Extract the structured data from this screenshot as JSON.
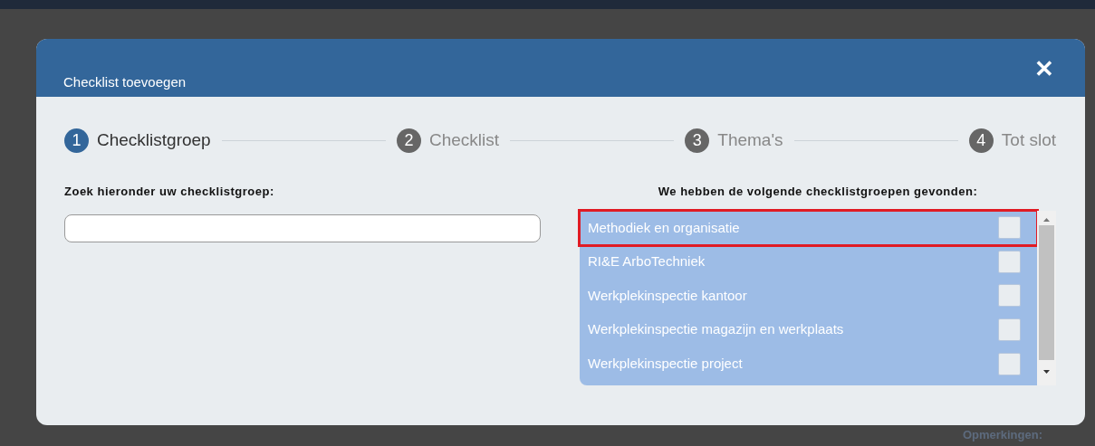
{
  "dialog": {
    "title": "Checklist toevoegen",
    "close": "✕"
  },
  "steps": [
    {
      "number": "1",
      "label": "Checklistgroep",
      "selected": true
    },
    {
      "number": "2",
      "label": "Checklist",
      "selected": false
    },
    {
      "number": "3",
      "label": "Thema's",
      "selected": false
    },
    {
      "number": "4",
      "label": "Tot slot",
      "selected": false
    }
  ],
  "search": {
    "label": "Zoek hieronder uw checklistgroep:"
  },
  "results": {
    "heading": "We hebben de volgende checklistgroepen gevonden:",
    "items": [
      {
        "label": "Methodiek en organisatie",
        "checked": false,
        "highlighted": true
      },
      {
        "label": "RI&E ArboTechniek",
        "checked": false,
        "highlighted": false
      },
      {
        "label": "Werkplekinspectie kantoor",
        "checked": false,
        "highlighted": false
      },
      {
        "label": "Werkplekinspectie magazijn en werkplaats",
        "checked": false,
        "highlighted": false
      },
      {
        "label": "Werkplekinspectie project",
        "checked": false,
        "highlighted": false
      }
    ]
  },
  "background": {
    "label": "Opmerkingen:"
  }
}
